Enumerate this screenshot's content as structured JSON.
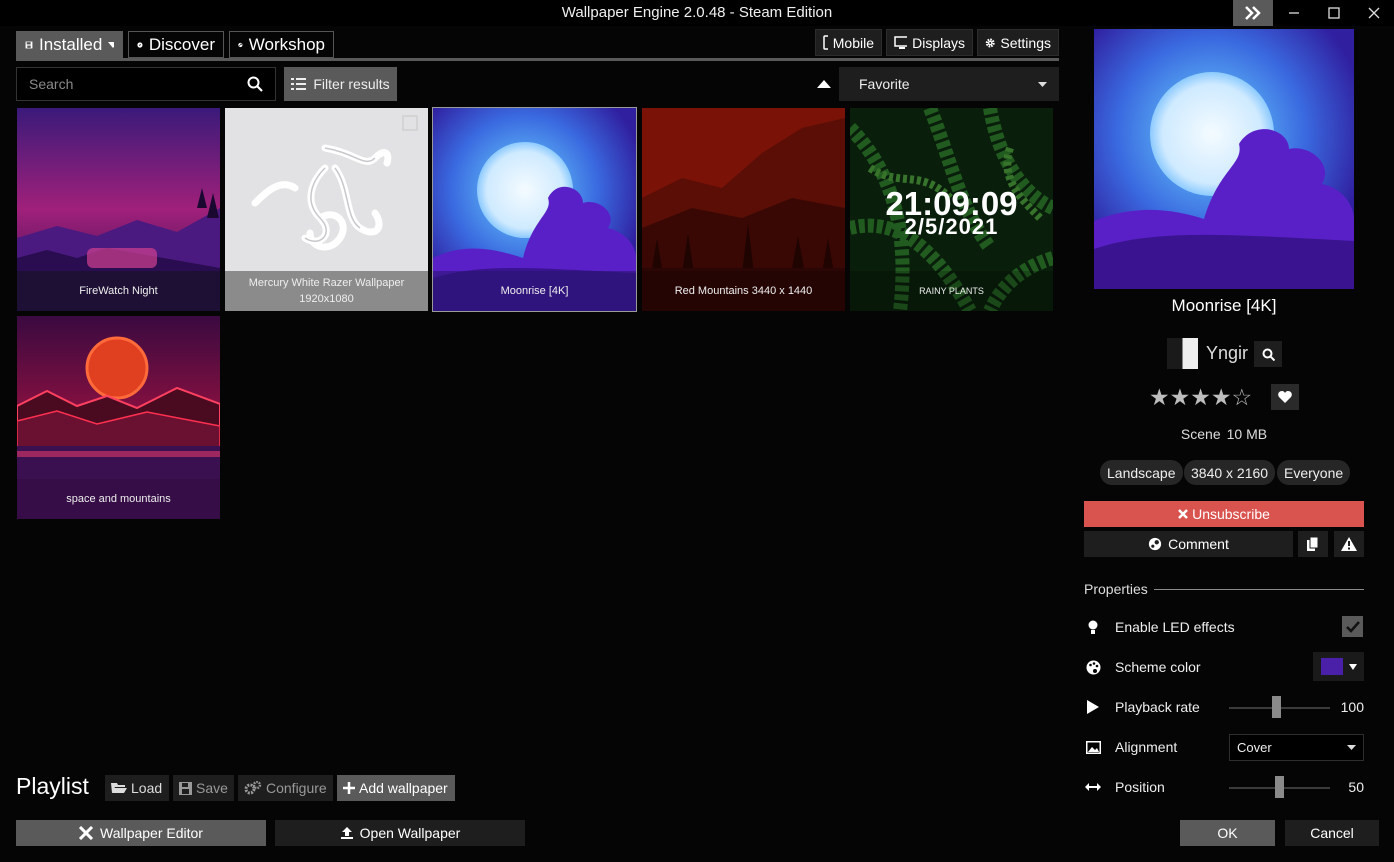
{
  "window": {
    "title": "Wallpaper Engine 2.0.48 - Steam Edition"
  },
  "tabs": {
    "installed": "Installed",
    "discover": "Discover",
    "workshop": "Workshop"
  },
  "header_buttons": {
    "mobile": "Mobile",
    "displays": "Displays",
    "settings": "Settings"
  },
  "search": {
    "placeholder": "Search",
    "filter_label": "Filter results",
    "sort_value": "Favorite"
  },
  "wallpapers": [
    {
      "title": "FireWatch Night",
      "subtitle": ""
    },
    {
      "title": "Mercury White Razer Wallpaper",
      "subtitle": "1920x1080"
    },
    {
      "title": "Moonrise [4K]",
      "subtitle": ""
    },
    {
      "title": "Red Mountains 3440 x 1440",
      "subtitle": ""
    },
    {
      "title": "RAINY PLANTS",
      "subtitle": "",
      "clock": "21:09:09",
      "date": "2/5/2021"
    },
    {
      "title": "space and mountains",
      "subtitle": ""
    }
  ],
  "playlist": {
    "title": "Playlist",
    "load": "Load",
    "save": "Save",
    "configure": "Configure",
    "add": "Add wallpaper"
  },
  "footer": {
    "editor": "Wallpaper Editor",
    "open": "Open Wallpaper",
    "ok": "OK",
    "cancel": "Cancel"
  },
  "details": {
    "title": "Moonrise [4K]",
    "author": "Yngir",
    "rating_stars": 4.5,
    "stars_text": "★★★★☆",
    "type": "Scene",
    "size": "10 MB",
    "tags": [
      "Landscape",
      "3840 x 2160",
      "Everyone"
    ],
    "unsubscribe": "Unsubscribe",
    "comment": "Comment"
  },
  "properties": {
    "title": "Properties",
    "led_label": "Enable LED effects",
    "led_enabled": true,
    "scheme_label": "Scheme color",
    "scheme_color": "#4a20a8",
    "playback_label": "Playback rate",
    "playback_value": "100",
    "alignment_label": "Alignment",
    "alignment_value": "Cover",
    "position_label": "Position",
    "position_value": "50"
  },
  "colors": {
    "accent_gray": "#5a5a5a",
    "danger": "#d9534f"
  }
}
